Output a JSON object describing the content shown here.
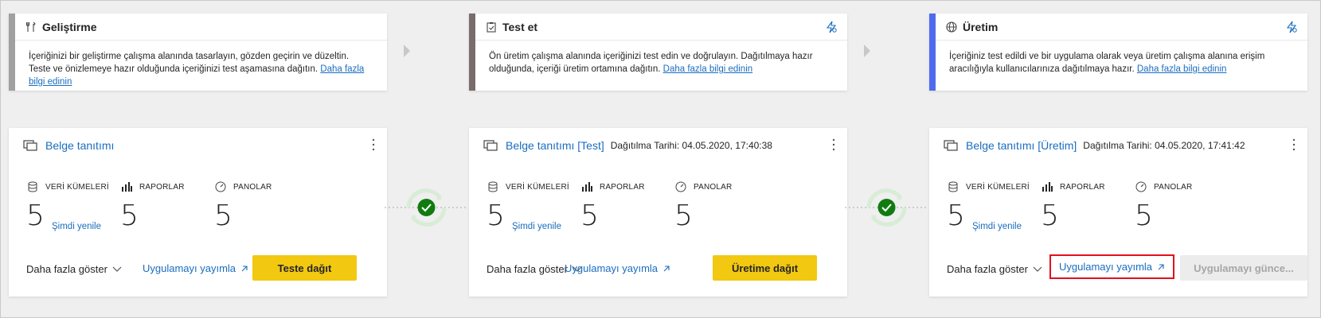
{
  "stages": [
    {
      "title": "Geliştirme",
      "icon": "tools-icon",
      "accent": "#a0a0a0",
      "description": "İçeriğinizi bir geliştirme çalışma alanında tasarlayın, gözden geçirin ve düzeltin. Teste ve önizlemeye hazır olduğunda içeriğinizi test aşamasına dağıtın.",
      "link": "Daha fazla bilgi edinin"
    },
    {
      "title": "Test et",
      "icon": "clipboard-check-icon",
      "accent": "#7a6c6c",
      "description": "Ön üretim çalışma alanında içeriğinizi test edin ve doğrulayın. Dağıtılmaya hazır olduğunda, içeriği üretim ortamına dağıtın.",
      "link": "Daha fazla bilgi edinin"
    },
    {
      "title": "Üretim",
      "icon": "globe-icon",
      "accent": "#4f6bed",
      "description": "İçeriğiniz test edildi ve bir uygulama olarak veya üretim çalışma alanına erişim aracılığıyla kullanıcılarınıza dağıtılmaya hazır.",
      "link": "Daha fazla bilgi edinin"
    }
  ],
  "cards": [
    {
      "workspace": "Belge tanıtımı",
      "date": "",
      "metrics": [
        {
          "label": "VERİ KÜMELERİ",
          "value": "5",
          "refresh": "Şimdi yenile"
        },
        {
          "label": "RAPORLAR",
          "value": "5"
        },
        {
          "label": "PANOLAR",
          "value": "5"
        }
      ],
      "show_more": "Daha fazla göster",
      "publish": "Uygulamayı yayımla",
      "action": "Teste dağıt"
    },
    {
      "workspace": "Belge tanıtımı [Test]",
      "date": "Dağıtılma Tarihi: 04.05.2020, 17:40:38",
      "metrics": [
        {
          "label": "VERİ KÜMELERİ",
          "value": "5",
          "refresh": "Şimdi yenile"
        },
        {
          "label": "RAPORLAR",
          "value": "5"
        },
        {
          "label": "PANOLAR",
          "value": "5"
        }
      ],
      "show_more": "Daha fazla göster",
      "publish": "Uygulamayı yayımla",
      "action": "Üretime dağıt"
    },
    {
      "workspace": "Belge tanıtımı [Üretim]",
      "date": "Dağıtılma Tarihi: 04.05.2020, 17:41:42",
      "metrics": [
        {
          "label": "VERİ KÜMELERİ",
          "value": "5",
          "refresh": "Şimdi yenile"
        },
        {
          "label": "RAPORLAR",
          "value": "5"
        },
        {
          "label": "PANOLAR",
          "value": "5"
        }
      ],
      "show_more": "Daha fazla göster",
      "publish": "Uygulamayı yayımla",
      "action": "Uygulamayı günce..."
    }
  ],
  "colors": {
    "link": "#1a6dbf",
    "primary_button": "#f2c811",
    "success": "#107c10",
    "highlight": "#e0101f"
  }
}
